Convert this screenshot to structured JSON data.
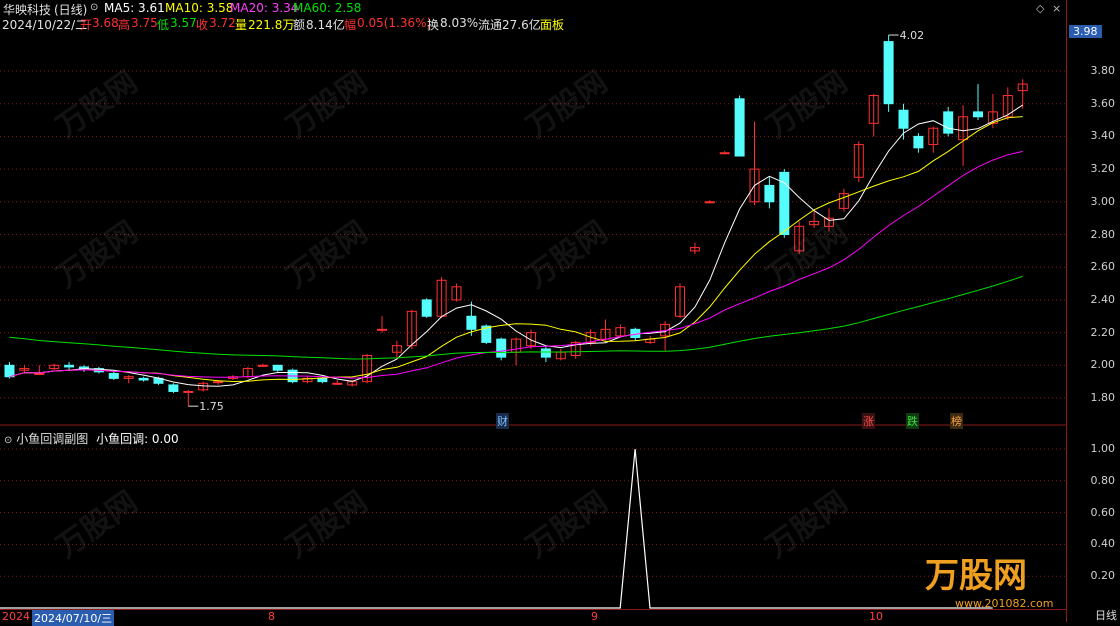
{
  "title": {
    "stock": "华映科技",
    "period": "(日线)",
    "ma5": "MA5: 3.61",
    "ma10": "MA10: 3.58",
    "ma20": "MA20: 3.34",
    "ma60": "MA60: 2.58"
  },
  "info": {
    "date": "2024/10/22/二",
    "open_label": "开",
    "open": "3.68",
    "high_label": "高",
    "high": "3.75",
    "low_label": "低",
    "low": "3.57",
    "close_label": "收",
    "close": "3.72",
    "vol_label": "量",
    "vol": "221.8万",
    "amt_label": "额",
    "amt": "8.14亿",
    "chg_label": "幅",
    "chg": "0.05(1.36%)",
    "turn_label": "换",
    "turn": "8.03%",
    "float_label": "流通",
    "float": "27.6亿",
    "panel": "面板"
  },
  "price_tag": "3.98",
  "high_mark": "4.02",
  "low_mark": "1.75",
  "y_axis_main": [
    "3.80",
    "3.60",
    "3.40",
    "3.20",
    "3.00",
    "2.80",
    "2.60",
    "2.40",
    "2.20",
    "2.00",
    "1.80"
  ],
  "y_axis_sub": [
    "1.00",
    "0.80",
    "0.60",
    "0.40",
    "0.20"
  ],
  "markers": {
    "cai": "财",
    "zhang": "涨",
    "die": "跌",
    "bang": "榜"
  },
  "sub": {
    "name": "小鱼回调副图",
    "value_label": "小鱼回调: 0.00"
  },
  "dates": {
    "start": "2024",
    "selected": "2024/07/10/三",
    "m8": "8",
    "m9": "9",
    "m10": "10"
  },
  "right_label": "日线",
  "watermark": "万股网",
  "watermark_url": "www.201082.com",
  "colors": {
    "up": "#ff3030",
    "down": "#54fcfc",
    "ma5": "#ffffff",
    "ma10": "#ffff00",
    "ma20": "#ff00ff",
    "ma60": "#00e000",
    "grid": "#8b1a1a"
  },
  "chart_data": [
    {
      "type": "candlestick",
      "ylim": [
        1.7,
        4.05
      ],
      "yticks": [
        1.8,
        2.0,
        2.2,
        2.4,
        2.6,
        2.8,
        3.0,
        3.2,
        3.4,
        3.6,
        3.8
      ],
      "candles": [
        [
          2.0,
          1.93,
          2.02,
          1.92
        ],
        [
          1.97,
          1.98,
          2.0,
          1.95
        ],
        [
          1.95,
          1.95,
          2.0,
          1.94
        ],
        [
          1.98,
          2.0,
          2.01,
          1.97
        ],
        [
          2.0,
          1.99,
          2.02,
          1.97
        ],
        [
          1.99,
          1.98,
          2.0,
          1.96
        ],
        [
          1.98,
          1.96,
          1.99,
          1.95
        ],
        [
          1.95,
          1.92,
          1.96,
          1.91
        ],
        [
          1.92,
          1.93,
          1.94,
          1.89
        ],
        [
          1.92,
          1.91,
          1.93,
          1.9
        ],
        [
          1.92,
          1.89,
          1.93,
          1.88
        ],
        [
          1.88,
          1.84,
          1.89,
          1.83
        ],
        [
          1.84,
          1.84,
          1.85,
          1.75
        ],
        [
          1.85,
          1.89,
          1.9,
          1.84
        ],
        [
          1.9,
          1.9,
          1.91,
          1.88
        ],
        [
          1.92,
          1.93,
          1.94,
          1.91
        ],
        [
          1.93,
          1.98,
          1.99,
          1.92
        ],
        [
          2.0,
          2.0,
          2.01,
          1.99
        ],
        [
          2.0,
          1.97,
          2.0,
          1.96
        ],
        [
          1.97,
          1.9,
          1.98,
          1.89
        ],
        [
          1.9,
          1.92,
          1.93,
          1.89
        ],
        [
          1.92,
          1.9,
          1.93,
          1.89
        ],
        [
          1.89,
          1.89,
          1.91,
          1.88
        ],
        [
          1.88,
          1.9,
          1.91,
          1.87
        ],
        [
          1.9,
          2.06,
          2.07,
          1.89
        ],
        [
          2.22,
          2.22,
          2.3,
          2.2
        ],
        [
          2.08,
          2.12,
          2.15,
          2.05
        ],
        [
          2.12,
          2.33,
          2.34,
          2.1
        ],
        [
          2.4,
          2.3,
          2.41,
          2.29
        ],
        [
          2.3,
          2.52,
          2.54,
          2.29
        ],
        [
          2.4,
          2.48,
          2.5,
          2.39
        ],
        [
          2.3,
          2.22,
          2.39,
          2.18
        ],
        [
          2.24,
          2.14,
          2.25,
          2.13
        ],
        [
          2.16,
          2.05,
          2.17,
          2.03
        ],
        [
          2.08,
          2.16,
          2.17,
          2.0
        ],
        [
          2.12,
          2.2,
          2.22,
          2.1
        ],
        [
          2.1,
          2.05,
          2.12,
          2.02
        ],
        [
          2.04,
          2.08,
          2.1,
          2.03
        ],
        [
          2.06,
          2.14,
          2.15,
          2.04
        ],
        [
          2.14,
          2.2,
          2.22,
          2.12
        ],
        [
          2.16,
          2.22,
          2.28,
          2.15
        ],
        [
          2.18,
          2.23,
          2.25,
          2.17
        ],
        [
          2.22,
          2.17,
          2.23,
          2.15
        ],
        [
          2.14,
          2.16,
          2.18,
          2.13
        ],
        [
          2.18,
          2.25,
          2.27,
          2.09
        ],
        [
          2.3,
          2.48,
          2.5,
          2.29
        ],
        [
          2.7,
          2.72,
          2.75,
          2.68
        ],
        [
          3.0,
          3.0,
          3.01,
          2.99
        ],
        [
          3.3,
          3.3,
          3.31,
          3.29
        ],
        [
          3.63,
          3.28,
          3.65,
          3.28
        ],
        [
          3.0,
          3.2,
          3.49,
          2.98
        ],
        [
          3.1,
          3.0,
          3.15,
          2.96
        ],
        [
          3.18,
          2.8,
          3.2,
          2.78
        ],
        [
          2.7,
          2.85,
          2.88,
          2.68
        ],
        [
          2.86,
          2.88,
          2.95,
          2.84
        ],
        [
          2.85,
          2.9,
          2.96,
          2.82
        ],
        [
          2.96,
          3.05,
          3.08,
          2.94
        ],
        [
          3.15,
          3.35,
          3.37,
          3.12
        ],
        [
          3.48,
          3.65,
          3.66,
          3.4
        ],
        [
          3.98,
          3.6,
          4.02,
          3.55
        ],
        [
          3.56,
          3.45,
          3.6,
          3.38
        ],
        [
          3.4,
          3.33,
          3.42,
          3.3
        ],
        [
          3.35,
          3.45,
          3.46,
          3.3
        ],
        [
          3.55,
          3.42,
          3.58,
          3.4
        ],
        [
          3.38,
          3.52,
          3.59,
          3.22
        ],
        [
          3.55,
          3.52,
          3.72,
          3.5
        ],
        [
          3.48,
          3.55,
          3.66,
          3.45
        ],
        [
          3.52,
          3.65,
          3.7,
          3.5
        ],
        [
          3.68,
          3.72,
          3.75,
          3.57
        ]
      ]
    },
    {
      "type": "line",
      "name": "小鱼回调",
      "ylim": [
        0,
        1.05
      ],
      "yticks": [
        0.2,
        0.4,
        0.6,
        0.8,
        1.0
      ],
      "values": [
        0,
        0,
        0,
        0,
        0,
        0,
        0,
        0,
        0,
        0,
        0,
        0,
        0,
        0,
        0,
        0,
        0,
        0,
        0,
        0,
        0,
        0,
        0,
        0,
        0,
        0,
        0,
        0,
        0,
        0,
        0,
        0,
        0,
        0,
        0,
        0,
        0,
        0,
        0,
        0,
        0,
        0,
        0,
        0,
        1,
        0,
        0,
        0,
        0,
        0,
        0,
        0,
        0,
        0,
        0,
        0,
        0,
        0,
        0,
        0,
        0,
        0,
        0,
        0,
        0,
        0,
        0,
        0,
        0
      ]
    }
  ]
}
